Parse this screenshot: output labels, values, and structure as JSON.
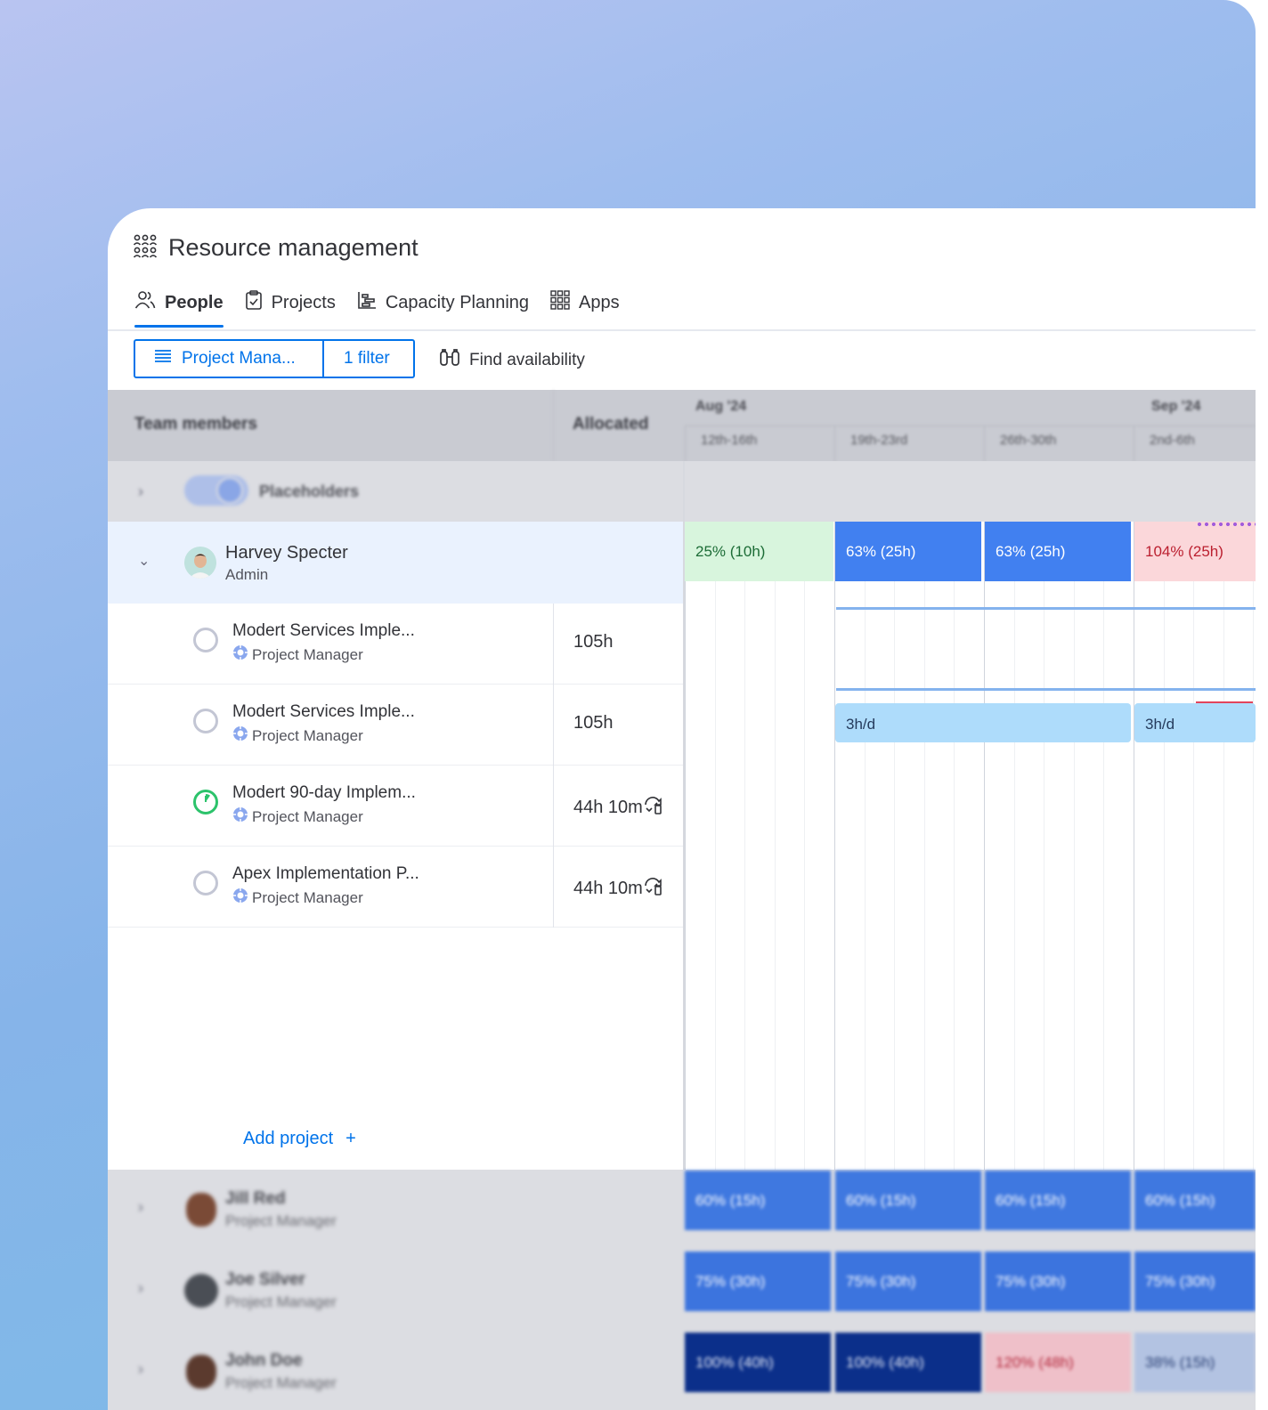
{
  "app": {
    "title": "Resource management"
  },
  "tabs": [
    {
      "label": "People",
      "active": true,
      "icon": "people-icon"
    },
    {
      "label": "Projects",
      "active": false,
      "icon": "clipboard-icon"
    },
    {
      "label": "Capacity Planning",
      "active": false,
      "icon": "capacity-icon"
    },
    {
      "label": "Apps",
      "active": false,
      "icon": "apps-grid-icon"
    }
  ],
  "toolbar": {
    "view_label": "Project Mana...",
    "filter_label": "1 filter",
    "find_label": "Find availability"
  },
  "table": {
    "col_members": "Team members",
    "col_allocated": "Allocated",
    "months": [
      "Aug '24",
      "Sep '24"
    ],
    "weeks": [
      "12th-16th",
      "19th-23rd",
      "26th-30th",
      "2nd-6th"
    ]
  },
  "placeholders": {
    "label": "Placeholders"
  },
  "harvey": {
    "name": "Harvey Specter",
    "role": "Admin",
    "weekly": [
      "25% (10h)",
      "63% (25h)",
      "63% (25h)",
      "104% (25h)"
    ]
  },
  "projects": [
    {
      "title": "Modert Services Imple...",
      "role": "Project Manager",
      "allocated": "105h",
      "status": "not-started"
    },
    {
      "title": "Modert Services Imple...",
      "role": "Project Manager",
      "allocated": "105h",
      "status": "not-started"
    },
    {
      "title": "Modert 90-day Implem...",
      "role": "Project Manager",
      "allocated": "44h 10m",
      "status": "in-progress"
    },
    {
      "title": "Apex Implementation P...",
      "role": "Project Manager",
      "allocated": "44h 10m",
      "status": "not-started"
    }
  ],
  "pills": [
    "3h/d",
    "3h/d"
  ],
  "add_project": {
    "label": "Add project",
    "icon": "+"
  },
  "members": [
    {
      "name": "Jill Red",
      "role": "Project Manager",
      "weekly": [
        "60% (15h)",
        "60% (15h)",
        "60% (15h)",
        "60% (15h)"
      ]
    },
    {
      "name": "Joe Silver",
      "role": "Project Manager",
      "weekly": [
        "75% (30h)",
        "75% (30h)",
        "75% (30h)",
        "75% (30h)"
      ]
    },
    {
      "name": "John Doe",
      "role": "Project Manager",
      "weekly": [
        "100% (40h)",
        "100% (40h)",
        "120% (48h)",
        "38% (15h)"
      ]
    }
  ],
  "colors": {
    "accent": "#0073ea",
    "under": "#d8f5dd",
    "allocated": "#4180f0",
    "over": "#fbd7da",
    "full": "#0b2f8a"
  }
}
